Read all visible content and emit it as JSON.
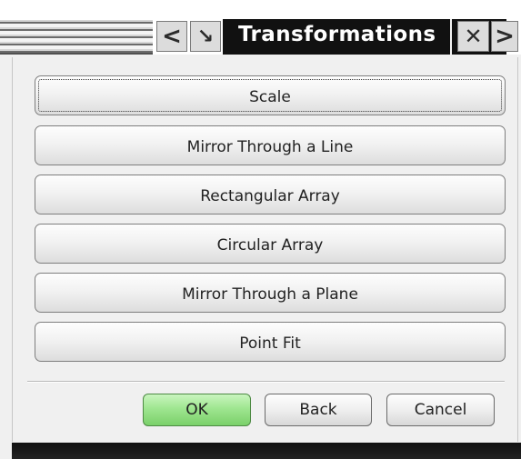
{
  "window": {
    "title": "Transformations",
    "controls": {
      "prev_glyph": "<",
      "arrow_glyph": "↘",
      "close_glyph": "✕",
      "next_glyph": ">"
    }
  },
  "actions": [
    {
      "label": "Scale",
      "focused": true
    },
    {
      "label": "Mirror Through a Line"
    },
    {
      "label": "Rectangular Array"
    },
    {
      "label": "Circular Array"
    },
    {
      "label": "Mirror Through a Plane"
    },
    {
      "label": "Point Fit"
    }
  ],
  "footer": {
    "ok_label": "OK",
    "back_label": "Back",
    "cancel_label": "Cancel"
  },
  "colors": {
    "title_bar": "#111111",
    "ok_button": "#9fe690",
    "panel": "#f0f0f0"
  },
  "icons": [
    "prev-arrow-icon",
    "snap-arrow-icon",
    "close-icon",
    "next-arrow-icon"
  ]
}
